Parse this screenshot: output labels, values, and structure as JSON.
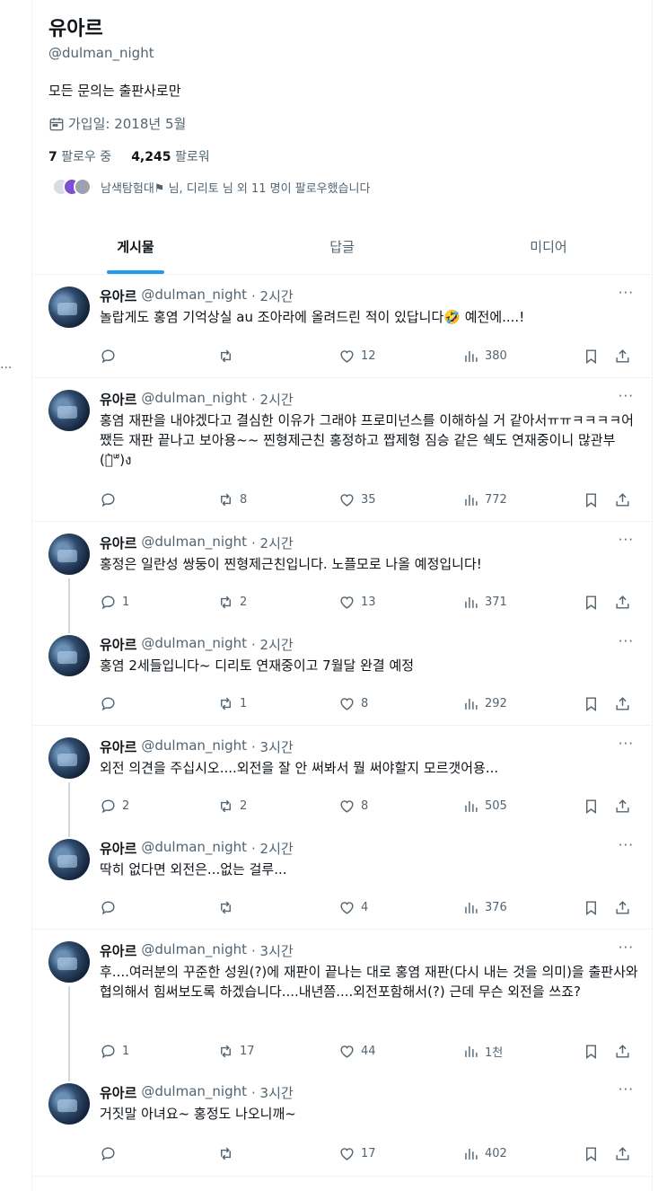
{
  "left_ellipsis": "...",
  "profile": {
    "name": "유아르",
    "handle": "@dulman_night",
    "bio": "모든 문의는 출판사로만",
    "joined": "가입일: 2018년 5월",
    "following_count": "7",
    "following_label": "팔로우 중",
    "followers_count": "4,245",
    "followers_label": "팔로워",
    "followed_by": "남색탐험대⚑ 님, 디리토 님 외 11 명이 팔로우했습니다"
  },
  "tabs": [
    {
      "label": "게시물",
      "active": true
    },
    {
      "label": "답글",
      "active": false
    },
    {
      "label": "미디어",
      "active": false
    }
  ],
  "tweets": [
    {
      "name": "유아르",
      "handle": "@dulman_night",
      "time": "· 2시간",
      "text": "놀랍게도 홍염 기억상실 au 조아라에 올려드린 적이 있답니다🤣 예전에....!",
      "replies": "",
      "retweets": "",
      "likes": "12",
      "views": "380"
    },
    {
      "name": "유아르",
      "handle": "@dulman_night",
      "time": "· 2시간",
      "text": "홍염 재판을 내야겠다고 결심한 이유가 그래야 프로미넌스를 이해하실 거 같아서ㅠㅠㅋㅋㅋㅋ어쨌든 재판 끝나고 보아용~~ 찐형제근친 홍정하고 짭제형 짐승 같은 쉑도 연재중이니 많관부(ว̀ᐜ́)ง",
      "replies": "",
      "retweets": "8",
      "likes": "35",
      "views": "772"
    },
    {
      "name": "유아르",
      "handle": "@dulman_night",
      "time": "· 2시간",
      "text": "홍정은 일란성 쌍둥이 찐형제근친입니다. 노플모로 나올 예정입니다!",
      "replies": "1",
      "retweets": "2",
      "likes": "13",
      "views": "371"
    },
    {
      "name": "유아르",
      "handle": "@dulman_night",
      "time": "· 2시간",
      "text": "홍염 2세들입니다~ 디리토 연재중이고 7월달 완결 예정",
      "replies": "",
      "retweets": "1",
      "likes": "8",
      "views": "292"
    },
    {
      "name": "유아르",
      "handle": "@dulman_night",
      "time": "· 3시간",
      "text": "외전 의견을 주십시오....외전을 잘 안 써봐서 뭘 써야할지 모르갯어용...",
      "replies": "2",
      "retweets": "2",
      "likes": "8",
      "views": "505"
    },
    {
      "name": "유아르",
      "handle": "@dulman_night",
      "time": "· 2시간",
      "text": "딱히 없다면 외전은...없는 걸루...",
      "replies": "",
      "retweets": "",
      "likes": "4",
      "views": "376"
    },
    {
      "name": "유아르",
      "handle": "@dulman_night",
      "time": "· 3시간",
      "text": "후....여러분의 꾸준한 성원(?)에 재판이 끝나는 대로 홍염 재판(다시 내는 것을 의미)을 출판사와 협의해서 힘써보도록 하겠습니다....내년쯤....외전포함해서(?) 근데 무슨 외전을 쓰죠?",
      "replies": "1",
      "retweets": "17",
      "likes": "44",
      "views": "1천"
    },
    {
      "name": "유아르",
      "handle": "@dulman_night",
      "time": "· 3시간",
      "text": "거짓말 아녀요~ 홍정도 나오니깨~",
      "replies": "",
      "retweets": "",
      "likes": "17",
      "views": "402"
    }
  ]
}
